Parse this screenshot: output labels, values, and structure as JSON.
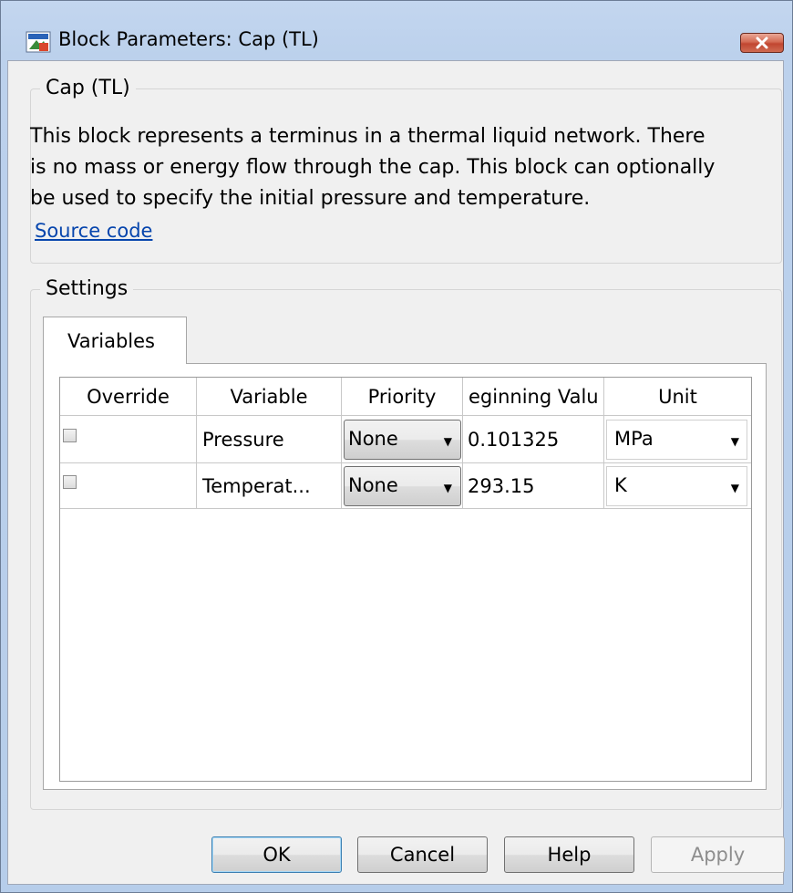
{
  "window": {
    "title": "Block Parameters: Cap (TL)"
  },
  "description_group": {
    "legend": "Cap (TL)",
    "lines": [
      "This block represents a terminus in a thermal liquid network. There",
      "is no mass or energy flow through the cap. This block can optionally",
      "be used to specify the initial pressure and temperature."
    ],
    "link": "Source code"
  },
  "settings_group": {
    "legend": "Settings",
    "tab": "Variables"
  },
  "table": {
    "headers": [
      "Override",
      "Variable",
      "Priority",
      "eginning Valu",
      "Unit"
    ],
    "rows": [
      {
        "override_checked": false,
        "variable": "Pressure",
        "priority": "None",
        "beginning_value": "0.101325",
        "unit": "MPa"
      },
      {
        "override_checked": false,
        "variable": "Temperat...",
        "priority": "None",
        "beginning_value": "293.15",
        "unit": "K"
      }
    ]
  },
  "buttons": {
    "ok": "OK",
    "cancel": "Cancel",
    "help": "Help",
    "apply": "Apply"
  },
  "icons": {
    "app": "simulink-block-icon",
    "close": "close-icon",
    "dropdown": "dropdown-arrow-icon"
  },
  "colors": {
    "link": "#0645ad",
    "close_button": "#c94b36",
    "frame": "#bcd1ec"
  }
}
